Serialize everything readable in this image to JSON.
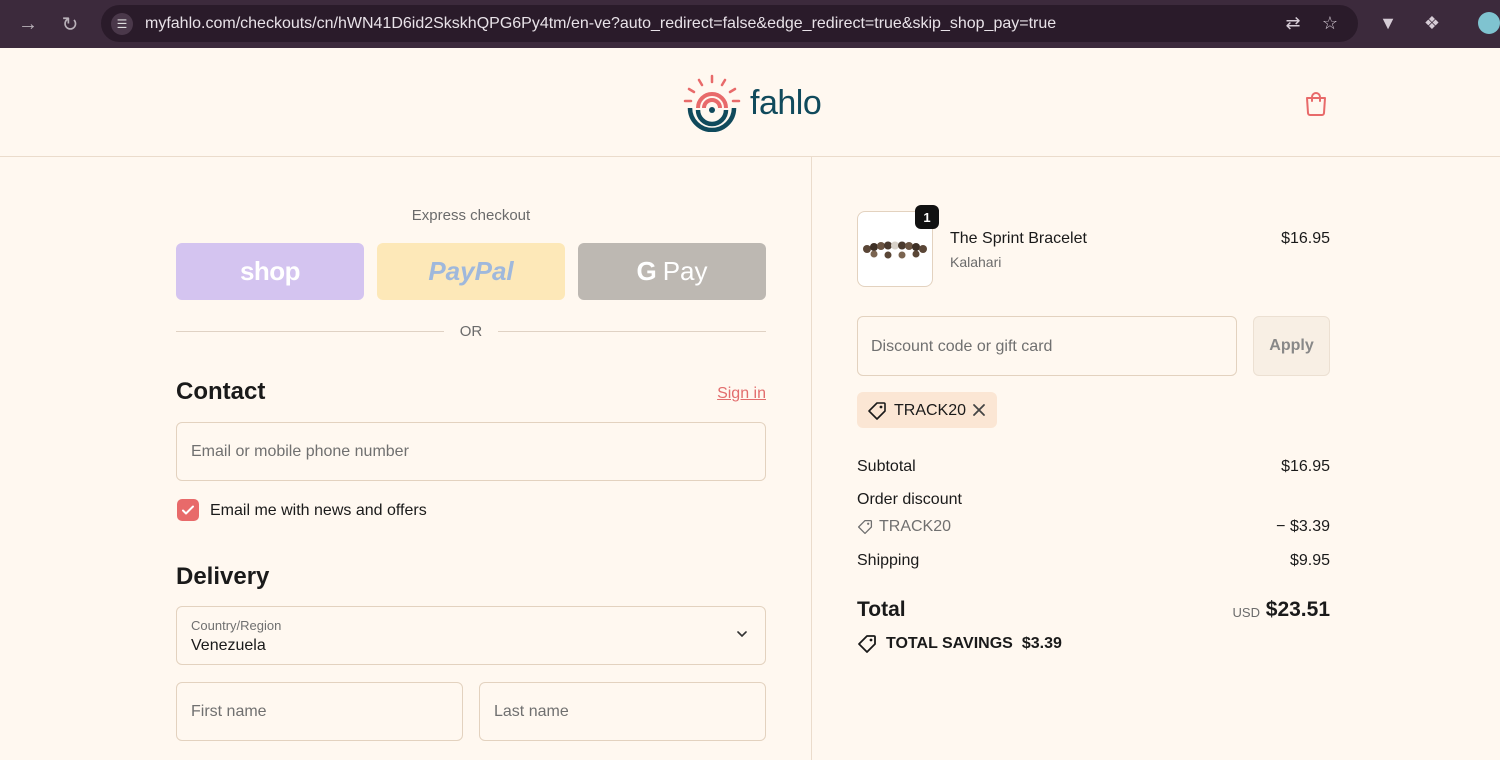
{
  "browser": {
    "url": "myfahlo.com/checkouts/cn/hWN41D6id2SkskhQPG6Py4tm/en-ve?auto_redirect=false&edge_redirect=true&skip_shop_pay=true"
  },
  "header": {
    "logo_text": "fahlo",
    "brand_color": "#104a5c",
    "accent_color": "#e86a6a"
  },
  "express": {
    "label": "Express checkout",
    "shop_label": "shop",
    "paypal_label": "PayPal",
    "gpay_label": "Pay",
    "gpay_g": "G"
  },
  "divider_text": "OR",
  "contact": {
    "title": "Contact",
    "signin_label": "Sign in",
    "email_placeholder": "Email or mobile phone number",
    "newsletter_label": "Email me with news and offers",
    "newsletter_checked": true
  },
  "delivery": {
    "title": "Delivery",
    "country_label": "Country/Region",
    "country_value": "Venezuela",
    "first_name_placeholder": "First name",
    "last_name_placeholder": "Last name"
  },
  "order": {
    "product": {
      "name": "The Sprint Bracelet",
      "variant": "Kalahari",
      "price": "$16.95",
      "quantity": "1"
    },
    "discount_placeholder": "Discount code or gift card",
    "apply_label": "Apply",
    "applied_code": "TRACK20",
    "subtotal_label": "Subtotal",
    "subtotal_value": "$16.95",
    "order_discount_label": "Order discount",
    "discount_code": "TRACK20",
    "discount_value": "− $3.39",
    "shipping_label": "Shipping",
    "shipping_value": "$9.95",
    "total_label": "Total",
    "total_currency": "USD",
    "total_value": "$23.51",
    "savings_label": "TOTAL SAVINGS",
    "savings_value": "$3.39"
  }
}
